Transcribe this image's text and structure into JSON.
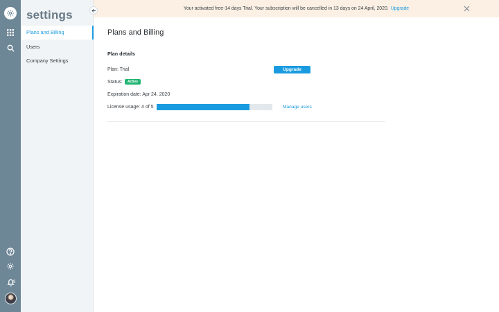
{
  "nav": {
    "icons": [
      "settings-logo-icon",
      "apps-grid-icon",
      "search-icon",
      "help-icon",
      "gear-icon",
      "bell-icon",
      "avatar"
    ],
    "notifications_count": "8"
  },
  "sidebar": {
    "title": "settings",
    "items": [
      {
        "label": "Plans and Billing",
        "active": true
      },
      {
        "label": "Users",
        "active": false
      },
      {
        "label": "Company Settings",
        "active": false
      }
    ]
  },
  "banner": {
    "text": "Your activated free-14 days Trial. Your subscription will be cancelled in 13 days on 24 April, 2020.",
    "link_label": "Upgrade"
  },
  "main": {
    "title": "Plans and Billing",
    "section_title": "Plan details",
    "plan_label": "Plan: Trial",
    "status_label": "Status:",
    "status_badge": "Active",
    "expiration_label": "Expiration date: Apr 24, 2020",
    "license_label": "License usage: 4 of 5",
    "license_used": 4,
    "license_total": 5,
    "upgrade_button": "Upgrade",
    "manage_users_link": "Manage users"
  },
  "colors": {
    "accent": "#1a9be0",
    "rail": "#6e8797",
    "status_active": "#22b573",
    "banner_bg": "#fcf0e4"
  }
}
